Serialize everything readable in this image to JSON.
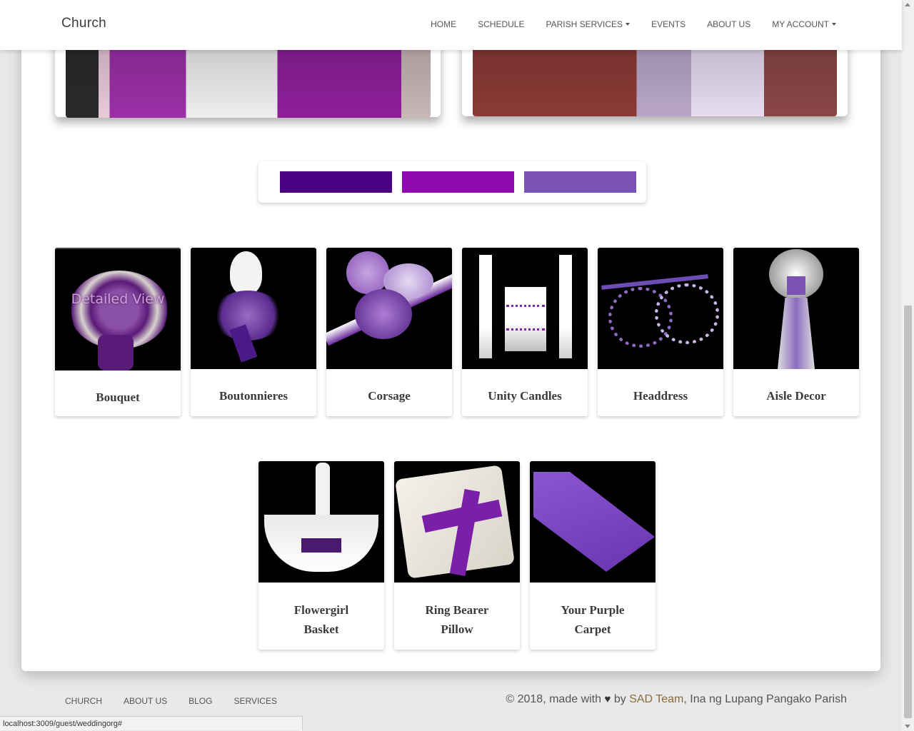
{
  "navbar": {
    "brand": "Church",
    "items": [
      {
        "label": "HOME",
        "has_caret": false
      },
      {
        "label": "SCHEDULE",
        "has_caret": false
      },
      {
        "label": "PARISH SERVICES",
        "has_caret": true
      },
      {
        "label": "EVENTS",
        "has_caret": false
      },
      {
        "label": "ABOUT US",
        "has_caret": false
      },
      {
        "label": "MY ACCOUNT",
        "has_caret": true
      }
    ]
  },
  "palette": {
    "colors": [
      "#4b0082",
      "#8e0ab0",
      "#7b52b5"
    ]
  },
  "products_row1": [
    {
      "title": "Bouquet",
      "overlay": "Detailed View"
    },
    {
      "title": "Boutonnieres"
    },
    {
      "title": "Corsage"
    },
    {
      "title": "Unity Candles"
    },
    {
      "title": "Headdress"
    },
    {
      "title": "Aisle Decor"
    }
  ],
  "products_row2": [
    {
      "title": "Flowergirl Basket"
    },
    {
      "title": "Ring Bearer Pillow"
    },
    {
      "title": "Your Purple Carpet"
    }
  ],
  "footer": {
    "links": [
      "CHURCH",
      "ABOUT US",
      "BLOG",
      "SERVICES"
    ],
    "copyright_prefix": "© 2018, made with",
    "copyright_by": "by",
    "team": "SAD Team",
    "copyright_suffix": ", Ina ng Lupang Pangako Parish"
  },
  "statusbar": {
    "url": "localhost:3009/guest/weddingorg#"
  }
}
